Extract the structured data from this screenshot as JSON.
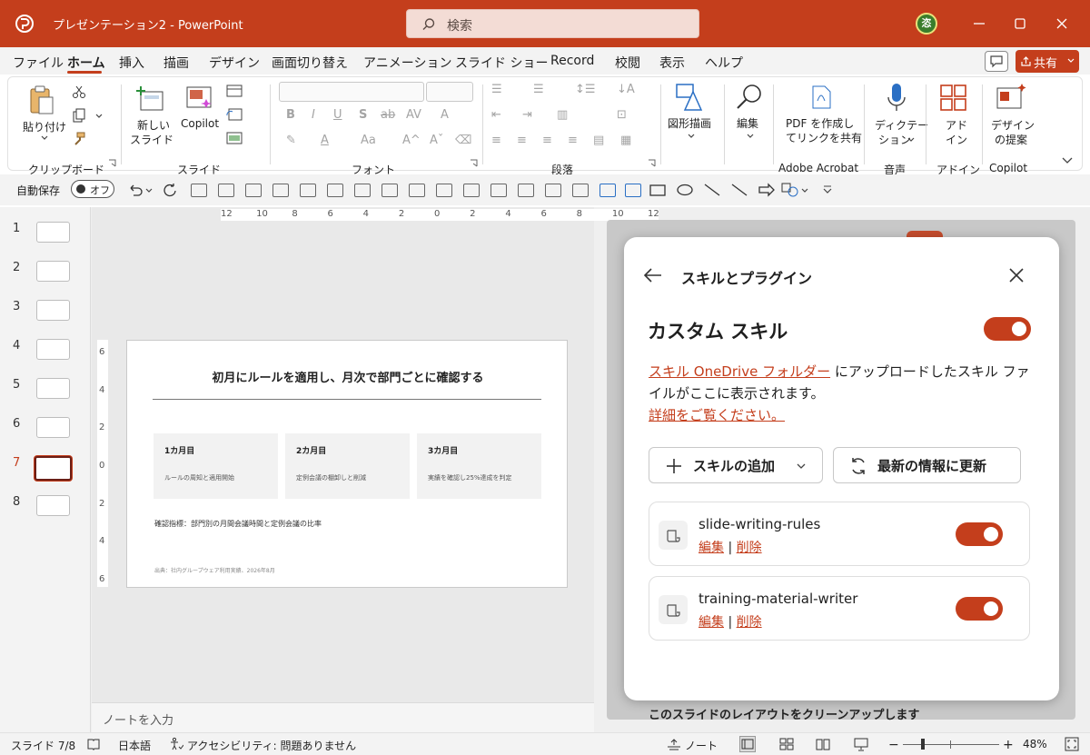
{
  "app": {
    "title": "プレゼンテーション2 - PowerPoint",
    "search_placeholder": "検索",
    "user_initial": "恣"
  },
  "menu": {
    "tabs": [
      "ファイル",
      "ホーム",
      "挿入",
      "描画",
      "デザイン",
      "画面切り替え",
      "アニメーション",
      "スライド ショー",
      "Record",
      "校閲",
      "表示",
      "ヘルプ"
    ],
    "share_label": "共有"
  },
  "ribbon": {
    "paste": "貼り付け",
    "new_slide_1": "新しい",
    "new_slide_2": "スライド",
    "copilot": "Copilot",
    "shapes": "図形描画",
    "editing": "編集",
    "pdf_1": "PDF を作成し",
    "pdf_2": "てリンクを共有",
    "dictate_1": "ディクテー",
    "dictate_2": "ション",
    "addin_1": "アド",
    "addin_2": "イン",
    "design_1": "デザイン",
    "design_2": "の提案",
    "groups": {
      "clipboard": "クリップボード",
      "slides": "スライド",
      "font": "フォント",
      "paragraph": "段落",
      "adobe": "Adobe Acrobat",
      "voice": "音声",
      "addins": "アドイン",
      "copilot": "Copilot"
    }
  },
  "qat": {
    "autosave_label": "自動保存",
    "autosave_state": "オフ"
  },
  "thumbnails": {
    "numbers": [
      "1",
      "2",
      "3",
      "4",
      "5",
      "6",
      "7",
      "8"
    ],
    "selected": "7"
  },
  "ruler": {
    "h_ticks": [
      "12",
      "10",
      "8",
      "6",
      "4",
      "2",
      "0",
      "2",
      "4",
      "6",
      "8",
      "10",
      "12"
    ],
    "v_ticks": [
      "6",
      "4",
      "2",
      "0",
      "2",
      "4",
      "6"
    ]
  },
  "slide": {
    "title": "初月にルールを適用し、月次で部門ごとに確認する",
    "cards": [
      {
        "head": "1カ月目",
        "body": "ルールの周知と適用開始"
      },
      {
        "head": "2カ月目",
        "body": "定例会議の棚卸しと削減"
      },
      {
        "head": "3カ月目",
        "body": "実績を確認し25%達成を判定"
      }
    ],
    "metric": "確認指標：部門別の月間会議時間と定例会議の比率",
    "source": "出典：社内グループウェア利用実績、2026年8月"
  },
  "notes_placeholder": "ノートを入力",
  "pane_footer": "このスライドのレイアウトをクリーンアップします",
  "dialog": {
    "title": "スキルとプラグイン",
    "section": "カスタム スキル",
    "section_toggle_on": true,
    "desc_link": "スキル OneDrive フォルダー",
    "desc_text": " にアップロードしたスキル ファイルがここに表示されます。",
    "desc_more": "詳細をご覧ください。",
    "add_skill": "スキルの追加",
    "refresh": "最新の情報に更新",
    "skills": [
      {
        "name": "slide-writing-rules",
        "edit": "編集",
        "sep": "|",
        "delete": "削除",
        "enabled": true
      },
      {
        "name": "training-material-writer",
        "edit": "編集",
        "sep": "|",
        "delete": "削除",
        "enabled": true
      }
    ]
  },
  "status": {
    "slide_pos": "スライド 7/8",
    "language": "日本語",
    "accessibility": "アクセシビリティ: 問題ありません",
    "notes": "ノート",
    "zoom": "48%"
  },
  "colors": {
    "accent": "#c43e1c"
  }
}
